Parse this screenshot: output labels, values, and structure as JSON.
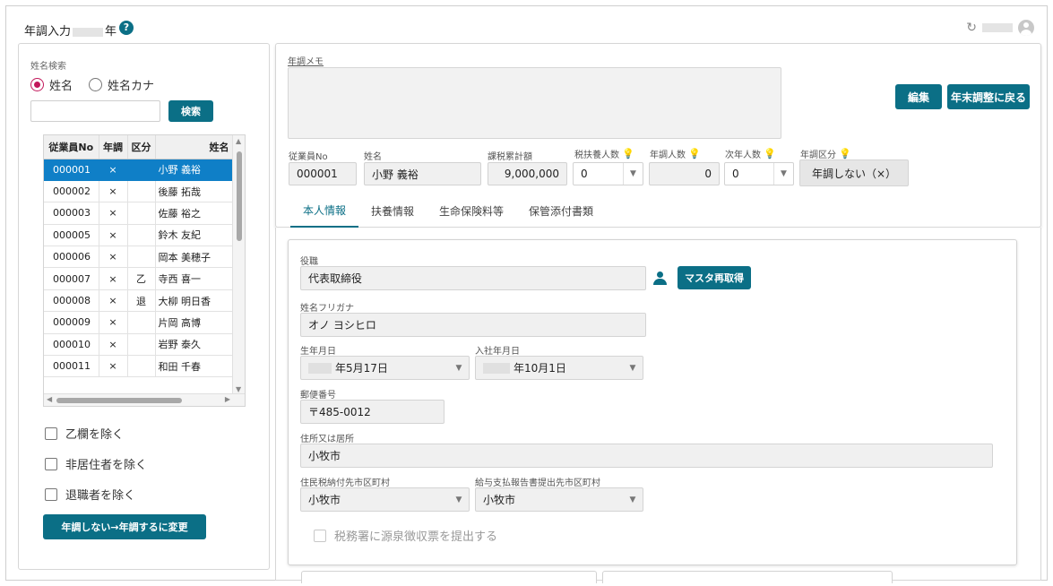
{
  "header": {
    "title_prefix": "年調入力",
    "title_suffix": "年",
    "help_label": "?"
  },
  "left": {
    "search_label": "姓名検索",
    "radio_options": [
      {
        "label": "姓名",
        "selected": true
      },
      {
        "label": "姓名カナ",
        "selected": false
      }
    ],
    "search_value": "",
    "search_button": "検索",
    "table": {
      "columns": [
        "従業員No",
        "年調",
        "区分",
        "姓名"
      ],
      "rows": [
        {
          "no": "000001",
          "nencho": "×",
          "kubun": "",
          "name": "小野 義裕",
          "selected": true
        },
        {
          "no": "000002",
          "nencho": "×",
          "kubun": "",
          "name": "後藤 拓哉"
        },
        {
          "no": "000003",
          "nencho": "×",
          "kubun": "",
          "name": "佐藤 裕之"
        },
        {
          "no": "000005",
          "nencho": "×",
          "kubun": "",
          "name": "鈴木 友紀"
        },
        {
          "no": "000006",
          "nencho": "×",
          "kubun": "",
          "name": "岡本 美穂子"
        },
        {
          "no": "000007",
          "nencho": "×",
          "kubun": "乙",
          "name": "寺西 喜一"
        },
        {
          "no": "000008",
          "nencho": "×",
          "kubun": "退",
          "name": "大柳 明日香"
        },
        {
          "no": "000009",
          "nencho": "×",
          "kubun": "",
          "name": "片岡 高博"
        },
        {
          "no": "000010",
          "nencho": "×",
          "kubun": "",
          "name": "岩野 泰久"
        },
        {
          "no": "000011",
          "nencho": "×",
          "kubun": "",
          "name": "和田 千春"
        }
      ]
    },
    "checkboxes": [
      "乙欄を除く",
      "非居住者を除く",
      "退職者を除く"
    ],
    "change_button": "年調しない→年調するに変更"
  },
  "top": {
    "memo_label": "年調メモ",
    "memo_value": "",
    "edit_button": "編集",
    "back_button": "年末調整に戻る",
    "fields": {
      "emp_no_label": "従業員No",
      "emp_no": "000001",
      "name_label": "姓名",
      "name": "小野 義裕",
      "taxable_label": "課税累計額",
      "taxable": "9,000,000",
      "dependents_label": "税扶養人数",
      "dependents": "0",
      "nencho_count_label": "年調人数",
      "nencho_count": "0",
      "next_year_label": "次年人数",
      "next_year": "0",
      "category_label": "年調区分",
      "category": "年調しない（×）"
    }
  },
  "tabs": [
    {
      "label": "本人情報",
      "active": true
    },
    {
      "label": "扶養情報",
      "active": false
    },
    {
      "label": "生命保険料等",
      "active": false
    },
    {
      "label": "保管添付書類",
      "active": false
    }
  ],
  "detail": {
    "position_label": "役職",
    "position": "代表取締役",
    "master_button": "マスタ再取得",
    "kana_label": "姓名フリガナ",
    "kana": "オノ ヨシヒロ",
    "birth_label": "生年月日",
    "birth": "年5月17日",
    "hire_label": "入社年月日",
    "hire": "年10月1日",
    "zip_label": "郵便番号",
    "zip": "〒485-0012",
    "address_label": "住所又は居所",
    "address": "小牧市",
    "resident_city_label": "住民税納付先市区町村",
    "resident_city": "小牧市",
    "report_city_label": "給与支払報告書提出先市区町村",
    "report_city": "小牧市",
    "tax_office_checkbox": "税務署に源泉徴収票を提出する"
  },
  "colors": {
    "accent": "#0b6f86",
    "selection": "#0f7fc7",
    "radio_selected": "#c2185b"
  },
  "icons": [
    "help-icon",
    "refresh-icon",
    "user-avatar-icon",
    "bulb-icon",
    "person-icon",
    "dropdown-arrow-icon"
  ]
}
